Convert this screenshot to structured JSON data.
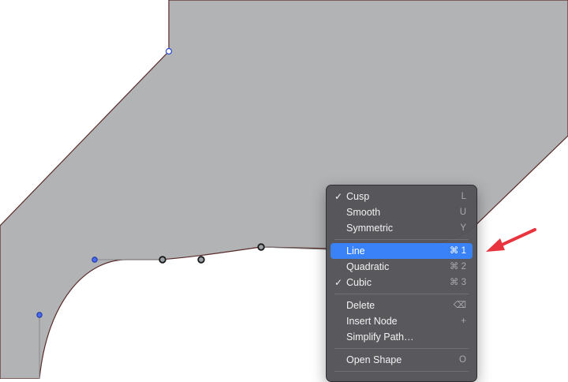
{
  "context_menu": {
    "node_types": [
      {
        "label": "Cusp",
        "shortcut": "L",
        "checked": true
      },
      {
        "label": "Smooth",
        "shortcut": "U",
        "checked": false
      },
      {
        "label": "Symmetric",
        "shortcut": "Y",
        "checked": false
      }
    ],
    "segment_types": [
      {
        "label": "Line",
        "shortcut": "⌘ 1",
        "checked": false,
        "highlighted": true
      },
      {
        "label": "Quadratic",
        "shortcut": "⌘ 2",
        "checked": false
      },
      {
        "label": "Cubic",
        "shortcut": "⌘ 3",
        "checked": true
      }
    ],
    "node_actions": [
      {
        "label": "Delete",
        "shortcut": "⌫"
      },
      {
        "label": "Insert Node",
        "shortcut": "+"
      },
      {
        "label": "Simplify Path…",
        "shortcut": ""
      }
    ],
    "shape_actions": [
      {
        "label": "Open Shape",
        "shortcut": "O"
      }
    ],
    "check_glyph": "✓"
  },
  "colors": {
    "shape_fill": "#b1b3b5",
    "shape_stroke": "#5a2a2a",
    "handle_blue": "#2a4bd7",
    "menu_bg": "#545458",
    "menu_highlight": "#3a82f7",
    "annotation_arrow": "#e8343f"
  },
  "icons": {
    "annotation": "red-arrow-icon",
    "checkmark": "checkmark-icon"
  }
}
